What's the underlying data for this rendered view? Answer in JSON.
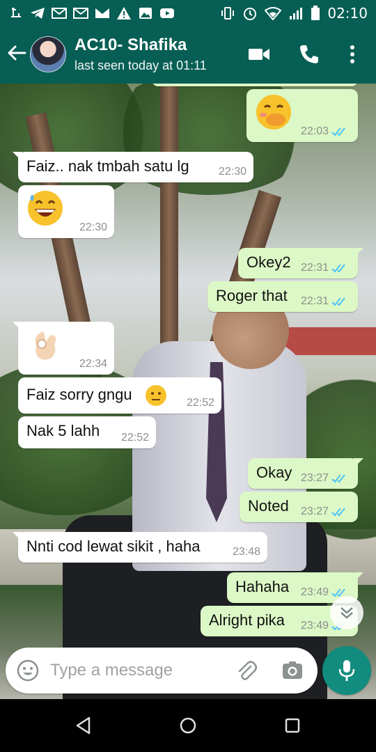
{
  "status_bar": {
    "time": "02:10",
    "left_icons": [
      "usb-icon",
      "telegram-icon",
      "gmail-icon",
      "gmail-icon",
      "gmail-icon",
      "warning-icon",
      "image-icon",
      "youtube-icon"
    ],
    "right_icons": [
      "vibrate-icon",
      "alarm-icon",
      "wifi-icon",
      "signal-icon",
      "battery-icon"
    ]
  },
  "header": {
    "contact_name": "AC10- Shafika",
    "contact_status": "last seen today at 01:11",
    "icons": [
      "back-arrow-icon",
      "video-call-icon",
      "voice-call-icon",
      "more-options-icon"
    ]
  },
  "messages": [
    {
      "dir": "out",
      "emoji": "face-with-hand-over-mouth",
      "time": "22:03",
      "read": true
    },
    {
      "dir": "in",
      "text": "Faiz.. nak tmbah satu lg",
      "time": "22:30"
    },
    {
      "dir": "in",
      "emoji": "grinning-face-with-sweat",
      "time": "22:30"
    },
    {
      "dir": "out",
      "text": "Okey2",
      "time": "22:31",
      "read": true
    },
    {
      "dir": "out",
      "text": "Roger that",
      "time": "22:31",
      "read": true
    },
    {
      "dir": "in",
      "emoji": "ok-hand",
      "time": "22:34"
    },
    {
      "dir": "in",
      "text": "Faiz sorry gngu",
      "emoji": "neutral-face",
      "time": "22:52"
    },
    {
      "dir": "in",
      "text": "Nak 5 lahh",
      "time": "22:52"
    },
    {
      "dir": "out",
      "text": "Okay",
      "time": "23:27",
      "read": true
    },
    {
      "dir": "out",
      "text": "Noted",
      "time": "23:27",
      "read": true
    },
    {
      "dir": "in",
      "text": "Nnti cod lewat sikit , haha",
      "time": "23:48"
    },
    {
      "dir": "out",
      "text": "Hahaha",
      "time": "23:49",
      "read": true
    },
    {
      "dir": "out",
      "text": "Alright pika",
      "time": "23:49",
      "read": true
    }
  ],
  "composer": {
    "placeholder": "Type a message",
    "value": "",
    "icons": [
      "emoji-icon",
      "attach-icon",
      "camera-icon",
      "mic-icon"
    ]
  },
  "colors": {
    "header": "#075e54",
    "outgoing_bubble": "#dcf8c6",
    "incoming_bubble": "#ffffff",
    "read_ticks": "#4fc3f7",
    "mic_button": "#128c7e"
  }
}
